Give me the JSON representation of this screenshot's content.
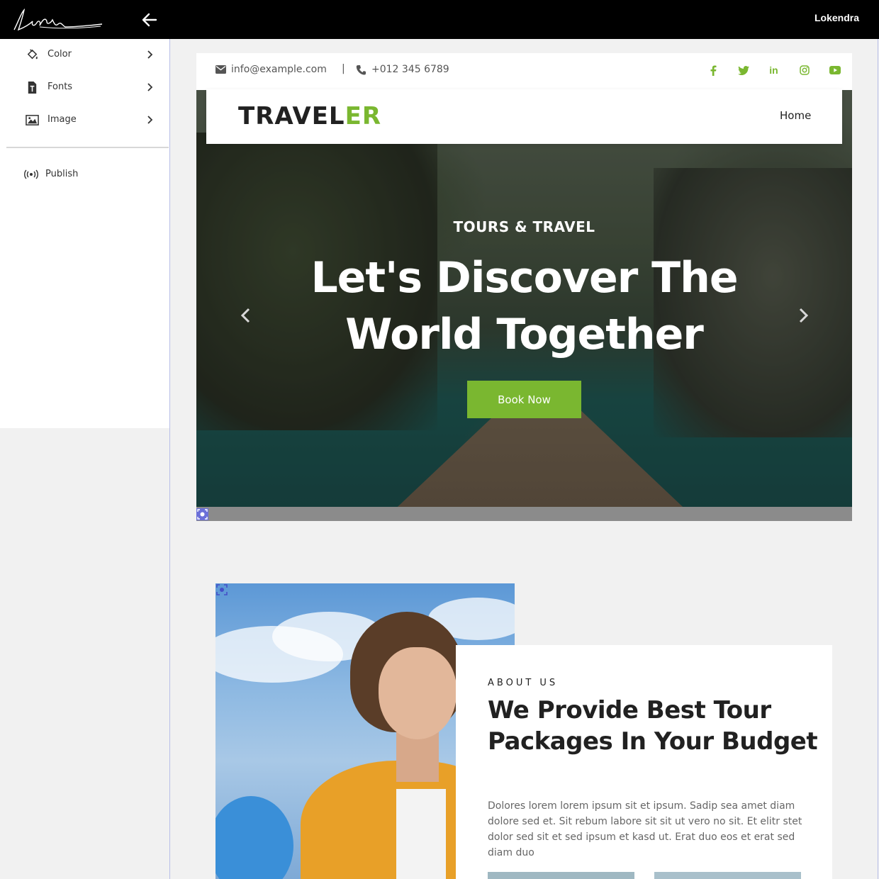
{
  "header": {
    "user_name": "Lokendra"
  },
  "sidebar": {
    "items": [
      {
        "label": "Color",
        "icon": "paint-bucket-icon"
      },
      {
        "label": "Fonts",
        "icon": "font-file-icon"
      },
      {
        "label": "Image",
        "icon": "image-icon"
      }
    ],
    "publish_label": "Publish"
  },
  "site": {
    "email": "info@example.com",
    "separator": "|",
    "phone": "+012 345 6789",
    "socials": [
      "f",
      "t",
      "in",
      "ig",
      "yt"
    ],
    "brand_part1": "TRAVEL",
    "brand_part2": "ER",
    "nav_home": "Home",
    "hero": {
      "kicker": "TOURS & TRAVEL",
      "title_line1": "Let's Discover The",
      "title_line2": "World Together",
      "button": "Book Now"
    },
    "about": {
      "kicker": "ABOUT US",
      "title": "We Provide Best Tour Packages In Your Budget",
      "text": "Dolores lorem lorem ipsum sit et ipsum. Sadip sea amet diam dolore sed et. Sit rebum labore sit sit ut vero no sit. Et elitr stet dolor sed sit et sed ipsum et kasd ut. Erat duo eos et erat sed diam duo"
    }
  },
  "colors": {
    "accent": "#7ab730",
    "topbar": "#000000",
    "canvas_border": "#b8bfe8"
  }
}
